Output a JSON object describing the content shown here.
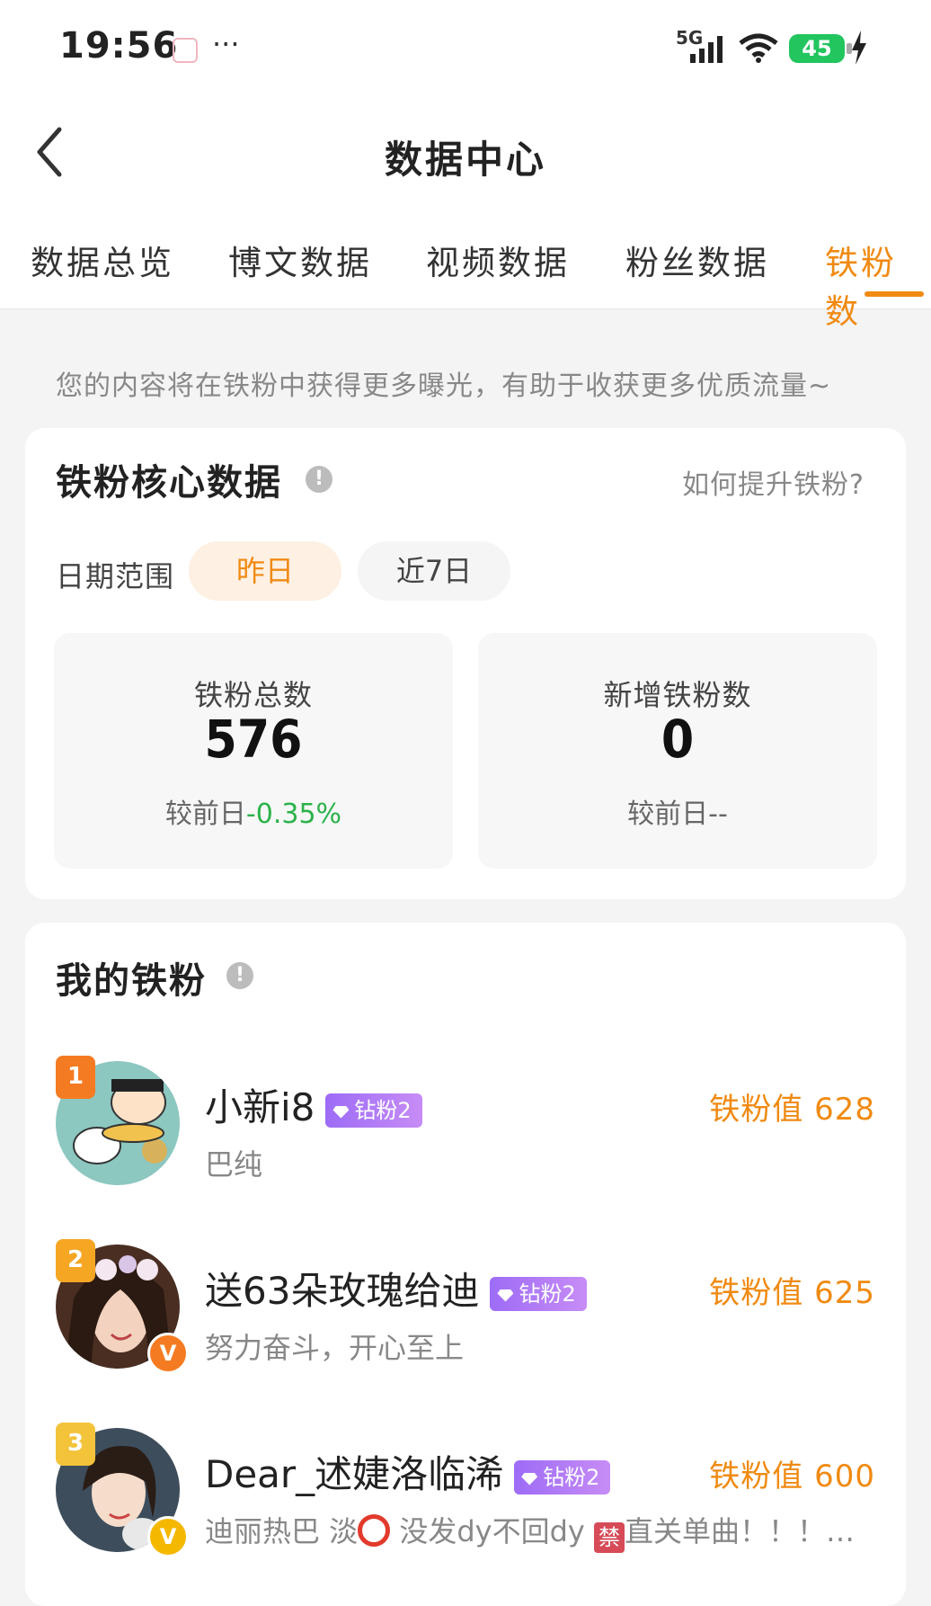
{
  "status_bar": {
    "time": "19:56",
    "network": "5G",
    "battery": "45",
    "more": "···"
  },
  "header": {
    "title": "数据中心",
    "back_icon": "chevron-left-icon"
  },
  "tabs": [
    {
      "label": "数据总览",
      "active": false
    },
    {
      "label": "博文数据",
      "active": false
    },
    {
      "label": "视频数据",
      "active": false
    },
    {
      "label": "粉丝数据",
      "active": false
    },
    {
      "label": "铁粉数",
      "active": true
    }
  ],
  "hint": "您的内容将在铁粉中获得更多曝光，有助于收获更多优质流量~",
  "core_card": {
    "title": "铁粉核心数据",
    "info_icon": "!",
    "help_link": "如何提升铁粉?",
    "date_range_label": "日期范围",
    "date_options": [
      "昨日",
      "近7日"
    ],
    "selected_date": "昨日",
    "stats": [
      {
        "label": "铁粉总数",
        "value": "576",
        "compare_prefix": "较前日",
        "compare_value": "-0.35%"
      },
      {
        "label": "新增铁粉数",
        "value": "0",
        "compare_prefix": "较前日",
        "compare_value": "--"
      }
    ]
  },
  "fans_card": {
    "title": "我的铁粉",
    "info_icon": "!",
    "fans": [
      {
        "rank": "1",
        "name": "小新i8",
        "tag": "钻粉2",
        "sub": "巴纯",
        "score": "铁粉值 628",
        "verified": ""
      },
      {
        "rank": "2",
        "name": "送63朵玫瑰给迪",
        "tag": "钻粉2",
        "sub": "努力奋斗，开心至上",
        "score": "铁粉值 625",
        "verified": "V"
      },
      {
        "rank": "3",
        "name": "Dear_述婕洛临浠",
        "tag": "钻粉2",
        "sub_parts": [
          "迪丽热巴 淡",
          "没发dy不回dy",
          "禁",
          "直关单曲！！！…"
        ],
        "score": "铁粉值 600",
        "verified": "V"
      }
    ]
  },
  "colors": {
    "accent": "#f08a12",
    "positive_change": "#2cb24a",
    "tag_purple": "#a874f6"
  }
}
